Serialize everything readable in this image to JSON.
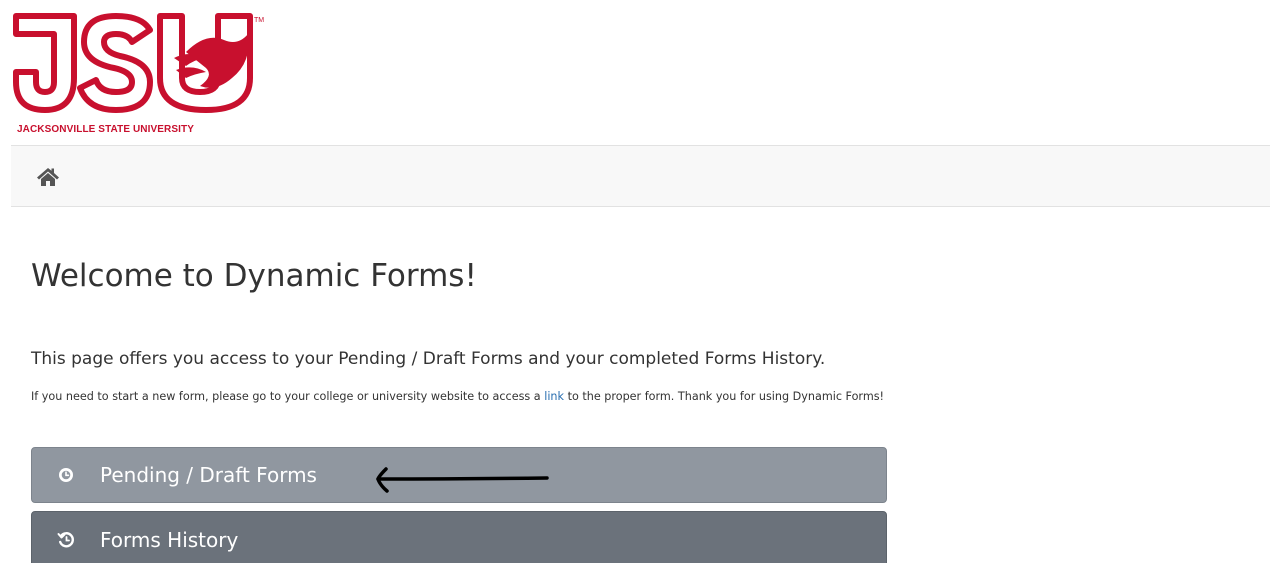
{
  "logo": {
    "letters": "JSU",
    "caption": "JACKSONVILLE STATE UNIVERSITY",
    "trademark": "TM",
    "color": "#c8102e"
  },
  "navbar": {
    "home_icon": "home-icon"
  },
  "main": {
    "title": "Welcome to Dynamic Forms!",
    "intro": "This page offers you access to your Pending / Draft Forms and your completed Forms History.",
    "note_before": "If you need to start a new form, please go to your college or university website to access a ",
    "note_link": "link",
    "note_after": " to the proper form. Thank you for using Dynamic Forms!"
  },
  "buttons": [
    {
      "label": "Pending / Draft Forms",
      "icon": "clock-icon",
      "color": "#9097a0"
    },
    {
      "label": "Forms History",
      "icon": "history-icon",
      "color": "#6b727b"
    }
  ],
  "annotation": {
    "icon": "hand-drawn-arrow-left",
    "color": "#000000"
  }
}
